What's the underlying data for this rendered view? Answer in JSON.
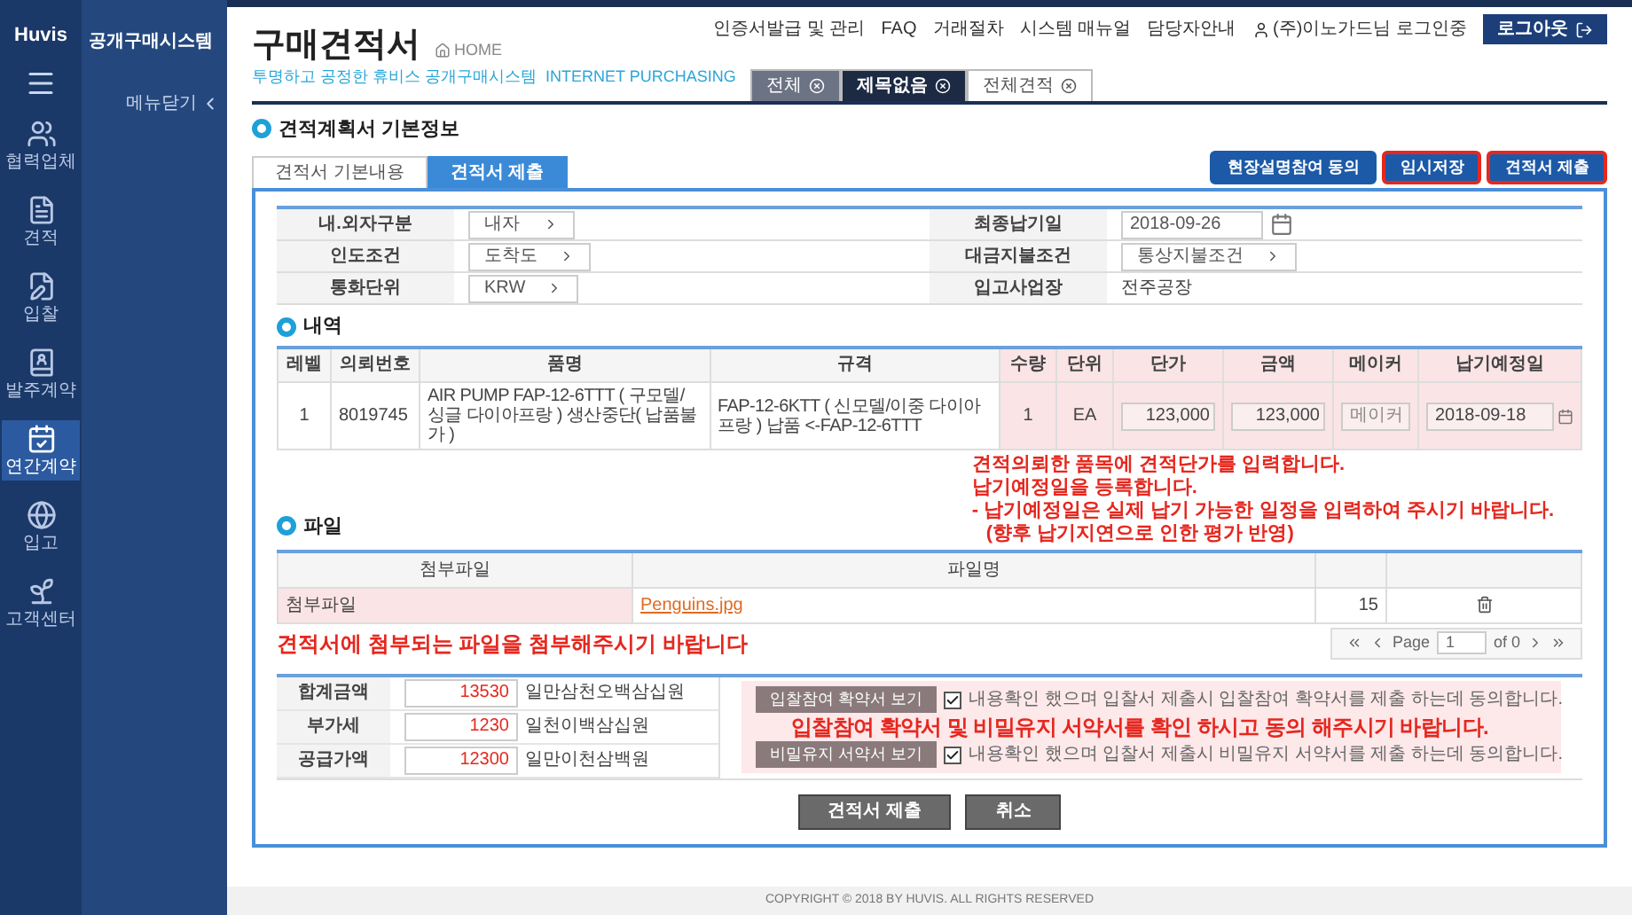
{
  "brand": {
    "logo": "Huvis",
    "system_title": "공개구매시스템",
    "menu_toggle": "메뉴닫기"
  },
  "sidebar": {
    "items": [
      {
        "label": "협력업체",
        "selected": false
      },
      {
        "label": "견적",
        "selected": false
      },
      {
        "label": "입찰",
        "selected": false
      },
      {
        "label": "발주계약",
        "selected": false
      },
      {
        "label": "연간계약",
        "selected": true
      },
      {
        "label": "입고",
        "selected": false
      },
      {
        "label": "고객센터",
        "selected": false
      }
    ]
  },
  "header": {
    "title": "구매견적서",
    "home": "HOME",
    "subtitle": "투명하고 공정한 휴비스 공개구매시스템",
    "subtitle_en": "INTERNET PURCHASING",
    "top_links": [
      "인증서발급 및 관리",
      "FAQ",
      "거래절차",
      "시스템 매뉴얼",
      "담당자안내"
    ],
    "user": "(주)이노가드님 로그인중",
    "logout": "로그아웃"
  },
  "page_tabs": [
    {
      "label": "전체",
      "kind": "pinned",
      "selected": false
    },
    {
      "label": "제목없음",
      "kind": "page",
      "selected": true
    },
    {
      "label": "전체견적",
      "kind": "page",
      "selected": false
    }
  ],
  "section_title": "견적계획서 기본정보",
  "subtabs": [
    {
      "label": "견적서 기본내용",
      "selected": false
    },
    {
      "label": "견적서 제출",
      "selected": true
    }
  ],
  "action_buttons": [
    {
      "label": "현장설명참여 동의",
      "highlighted": false
    },
    {
      "label": "임시저장",
      "highlighted": true
    },
    {
      "label": "견적서 제출",
      "highlighted": true
    }
  ],
  "form": [
    [
      {
        "label": "내.외자구분",
        "value": "내자",
        "kind": "select"
      },
      {
        "label": "최종납기일",
        "value": "2018-09-26",
        "kind": "date"
      }
    ],
    [
      {
        "label": "인도조건",
        "value": "도착도",
        "kind": "select"
      },
      {
        "label": "대금지불조건",
        "value": "통상지불조건",
        "kind": "select"
      }
    ],
    [
      {
        "label": "통화단위",
        "value": "KRW",
        "kind": "select"
      },
      {
        "label": "입고사업장",
        "value": "전주공장",
        "kind": "text"
      }
    ]
  ],
  "items": {
    "title": "내역",
    "columns": [
      "레벨",
      "의뢰번호",
      "품명",
      "규격",
      "수량",
      "단위",
      "단가",
      "금액",
      "메이커",
      "납기예정일"
    ],
    "rows": [
      {
        "level": "1",
        "request_no": "8019745",
        "name": "AIR PUMP FAP-12-6TTT ( 구모델/싱글 다이아프랑 ) 생산중단( 납품불가 )",
        "spec": "FAP-12-6KTT ( 신모델/이중 다이아프랑 ) 납품 <-FAP-12-6TTT",
        "qty": "1",
        "unit": "EA",
        "unit_price": "123,000",
        "amount": "123,000",
        "maker_placeholder": "메이커",
        "due_date": "2018-09-18"
      }
    ],
    "note": [
      "견적의뢰한 품목에 견적단가를 입력합니다.",
      "납기예정일을 등록합니다.",
      "- 납기예정일은 실제 납기 가능한 일정을 입력하여 주시기 바랍니다.",
      "(향후 납기지연으로 인한 평가 반영)"
    ]
  },
  "files": {
    "title": "파일",
    "columns": [
      "첨부파일",
      "파일명"
    ],
    "rows": [
      {
        "type": "첨부파일",
        "name": "Penguins.jpg",
        "size": "15"
      }
    ],
    "pager": {
      "label": "Page",
      "page": "1",
      "of": "of 0"
    },
    "note": "견적서에 첨부되는 파일을 첨부해주시기 바랍니다"
  },
  "totals": [
    {
      "label": "합계금액",
      "value": "13530",
      "words": "일만삼천오백삼십원"
    },
    {
      "label": "부가세",
      "value": "1230",
      "words": "일천이백삼십원"
    },
    {
      "label": "공급가액",
      "value": "12300",
      "words": "일만이천삼백원"
    }
  ],
  "agreements": [
    {
      "button": "입찰참여 확약서 보기",
      "text": "내용확인 했으며 입찰서 제출시 입찰참여 확약서를 제출 하는데 동의합니다.",
      "checked": true
    },
    {
      "button": "비밀유지 서약서 보기",
      "text": "내용확인 했으며 입찰서 제출시 비밀유지 서약서를 제출 하는데 동의합니다.",
      "checked": true
    }
  ],
  "agreement_note": "입찰참여 확약서 및 비밀유지 서약서를 확인 하시고 동의 해주시기 바랍니다.",
  "bottom_buttons": [
    "견적서 제출",
    "취소"
  ],
  "footer": "COPYRIGHT © 2018 BY HUVIS. ALL RIGHTS RESERVED"
}
